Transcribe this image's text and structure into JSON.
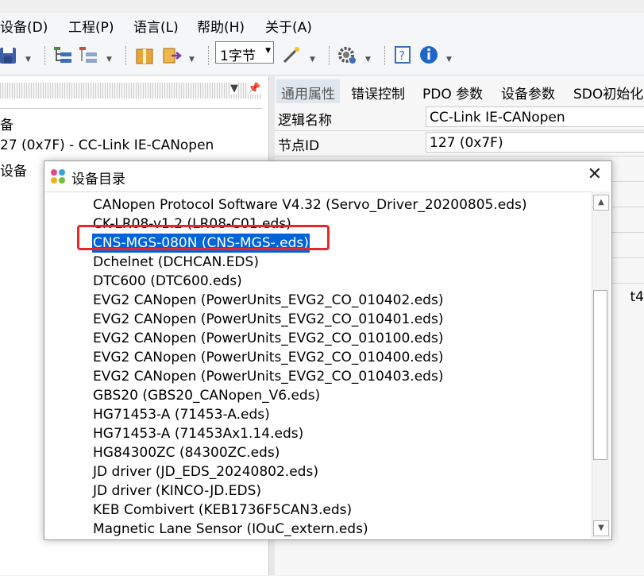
{
  "menu": {
    "items": [
      "设备(D)",
      "工程(P)",
      "语言(L)",
      "帮助(H)",
      "关于(A)"
    ]
  },
  "toolbar": {
    "byte_combo_value": "1字节",
    "icons": [
      "save-icon",
      "add-node-icon",
      "remove-node-icon",
      "package-icon",
      "export-icon",
      "wand-icon",
      "settings-gear-icon",
      "help-icon",
      "info-icon"
    ]
  },
  "left_pane": {
    "tree": [
      "备",
      "27 (0x7F)  -  CC-Link IE-CANopen",
      "设备"
    ]
  },
  "right_pane": {
    "tabs": [
      "通用属性",
      "错误控制",
      "PDO 参数",
      "设备参数",
      "SDO初始化"
    ],
    "props": [
      {
        "key": "逻辑名称",
        "value": "CC-Link IE-CANopen"
      },
      {
        "key": "节点ID",
        "value": "127 (0x7F)"
      }
    ],
    "fragment": "t4"
  },
  "dialog": {
    "title": "设备目录",
    "close_label": "✕",
    "selected_index": 2,
    "items": [
      "CANopen Protocol Software V4.32 (Servo_Driver_20200805.eds)",
      "CK-LR08-v1.2 (LR08-C01.eds)",
      "CNS-MGS-080N (CNS-MGS-.eds)",
      "Dchelnet (DCHCAN.EDS)",
      "DTC600 (DTC600.eds)",
      "EVG2 CANopen (PowerUnits_EVG2_CO_010402.eds)",
      "EVG2 CANopen (PowerUnits_EVG2_CO_010401.eds)",
      "EVG2 CANopen (PowerUnits_EVG2_CO_010100.eds)",
      "EVG2 CANopen (PowerUnits_EVG2_CO_010400.eds)",
      "EVG2 CANopen (PowerUnits_EVG2_CO_010403.eds)",
      "GBS20 (GBS20_CANopen_V6.eds)",
      "HG71453-A (71453-A.eds)",
      "HG71453-A (71453Ax1.14.eds)",
      "HG84300ZC (84300ZC.eds)",
      "JD driver (JD_EDS_20240802.eds)",
      "JD driver (KINCO-JD.EDS)",
      "KEB Combivert (KEB1736F5CAN3.eds)",
      "Magnetic Lane Sensor (IOuC_extern.eds)"
    ]
  },
  "colors": {
    "selection": "#0063d8",
    "annotation_box": "#e8262a"
  }
}
